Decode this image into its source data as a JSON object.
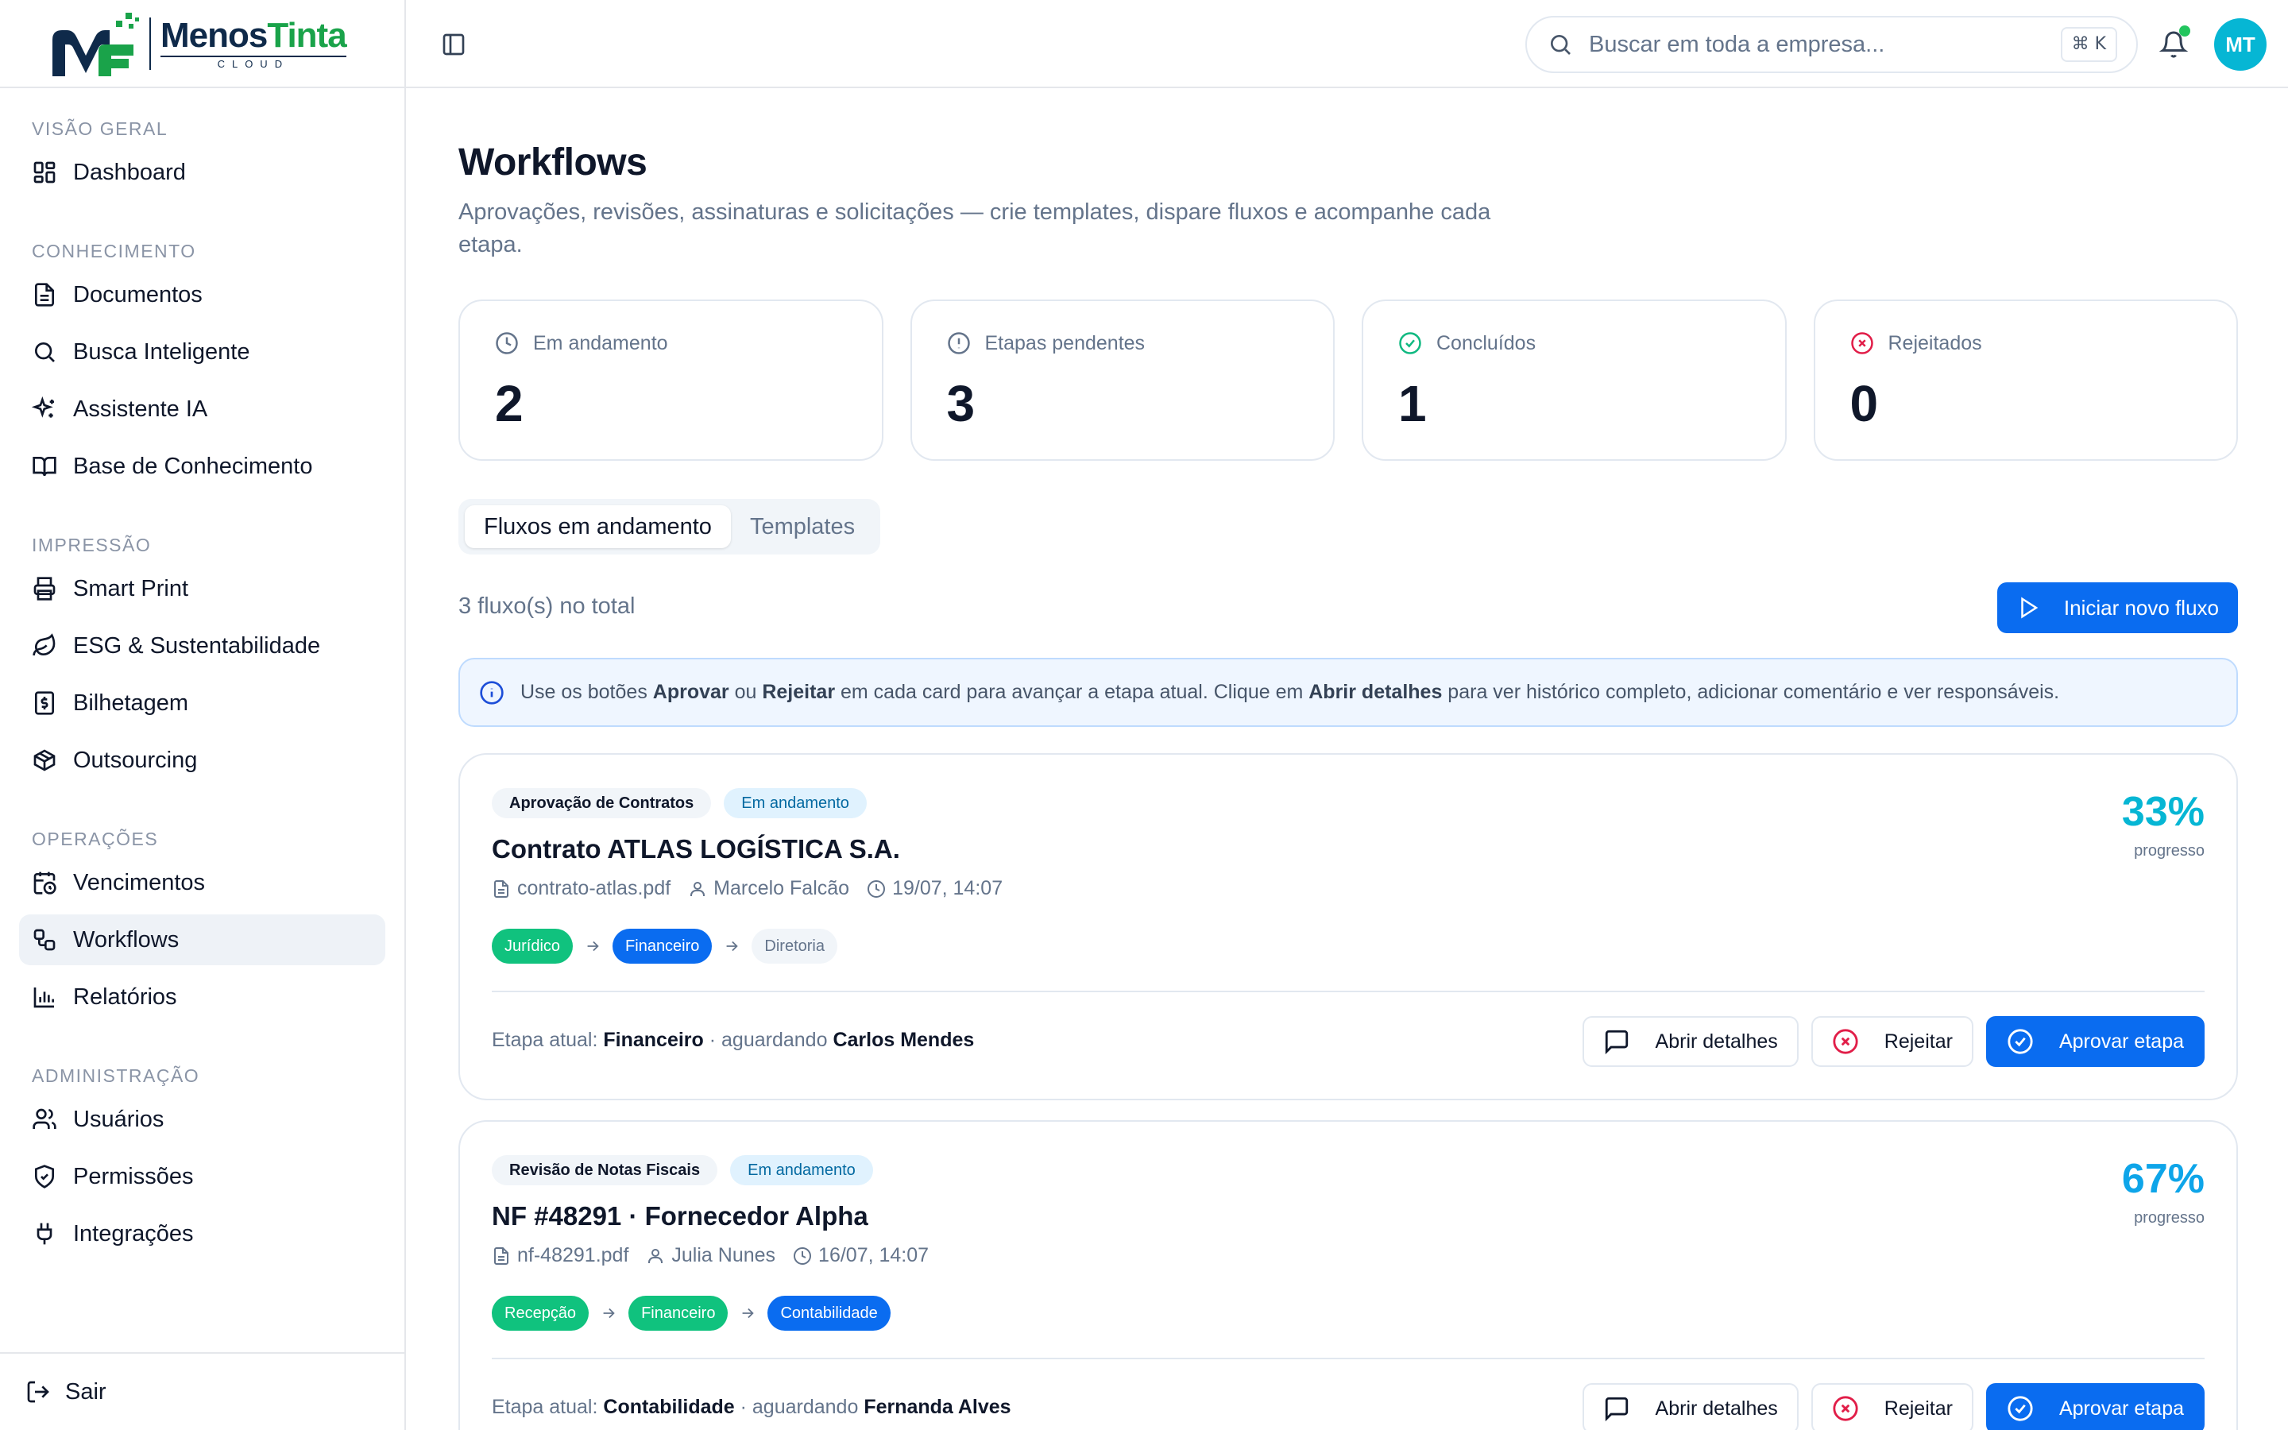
{
  "brand": {
    "name_part1": "Menos",
    "name_part2": "Tinta",
    "sub": "CLOUD"
  },
  "sidebar": {
    "sections": [
      {
        "title": "VISÃO GERAL",
        "items": [
          {
            "label": "Dashboard",
            "icon": "dashboard-icon"
          }
        ]
      },
      {
        "title": "CONHECIMENTO",
        "items": [
          {
            "label": "Documentos",
            "icon": "file-icon"
          },
          {
            "label": "Busca Inteligente",
            "icon": "search-icon"
          },
          {
            "label": "Assistente IA",
            "icon": "sparkles-icon"
          },
          {
            "label": "Base de Conhecimento",
            "icon": "book-icon"
          }
        ]
      },
      {
        "title": "IMPRESSÃO",
        "items": [
          {
            "label": "Smart Print",
            "icon": "printer-icon"
          },
          {
            "label": "ESG & Sustentabilidade",
            "icon": "leaf-icon"
          },
          {
            "label": "Bilhetagem",
            "icon": "receipt-icon"
          },
          {
            "label": "Outsourcing",
            "icon": "package-icon"
          }
        ]
      },
      {
        "title": "OPERAÇÕES",
        "items": [
          {
            "label": "Vencimentos",
            "icon": "calendar-clock-icon"
          },
          {
            "label": "Workflows",
            "icon": "workflow-icon",
            "active": true
          },
          {
            "label": "Relatórios",
            "icon": "bar-chart-icon"
          }
        ]
      },
      {
        "title": "ADMINISTRAÇÃO",
        "items": [
          {
            "label": "Usuários",
            "icon": "users-icon"
          },
          {
            "label": "Permissões",
            "icon": "shield-icon"
          },
          {
            "label": "Integrações",
            "icon": "plug-icon"
          }
        ]
      }
    ],
    "logout": "Sair"
  },
  "topbar": {
    "search_placeholder": "Buscar em toda a empresa...",
    "shortcut": "⌘ K",
    "avatar": "MT"
  },
  "page": {
    "title": "Workflows",
    "subtitle": "Aprovações, revisões, assinaturas e solicitações — crie templates, dispare fluxos e acompanhe cada etapa."
  },
  "stats": [
    {
      "label": "Em andamento",
      "value": "2",
      "icon": "clock-icon",
      "color": "#64748b"
    },
    {
      "label": "Etapas pendentes",
      "value": "3",
      "icon": "alert-circle-icon",
      "color": "#64748b"
    },
    {
      "label": "Concluídos",
      "value": "1",
      "icon": "check-circle-icon",
      "color": "#10b981"
    },
    {
      "label": "Rejeitados",
      "value": "0",
      "icon": "x-circle-icon",
      "color": "#e11d48"
    }
  ],
  "tabs": [
    "Fluxos em andamento",
    "Templates"
  ],
  "list": {
    "total": "3 fluxo(s) no total",
    "new_flow": "Iniciar novo fluxo",
    "info_pre": "Use os botões ",
    "info_b1": "Aprovar",
    "info_mid1": " ou ",
    "info_b2": "Rejeitar",
    "info_mid2": " em cada card para avançar a etapa atual. Clique em ",
    "info_b3": "Abrir detalhes",
    "info_post": " para ver histórico completo, adicionar comentário e ver responsáveis."
  },
  "flows": [
    {
      "type": "Aprovação de Contratos",
      "status": "Em andamento",
      "title": "Contrato ATLAS LOGÍSTICA S.A.",
      "file": "contrato-atlas.pdf",
      "owner": "Marcelo Falcão",
      "date": "19/07, 14:07",
      "progress": "33%",
      "progress_label": "progresso",
      "steps": [
        {
          "label": "Jurídico",
          "state": "done"
        },
        {
          "label": "Financeiro",
          "state": "current"
        },
        {
          "label": "Diretoria",
          "state": "todo"
        }
      ],
      "current_prefix": "Etapa atual: ",
      "current_step": "Financeiro",
      "waiting_prefix": " · aguardando ",
      "waiting_person": "Carlos Mendes",
      "btn_details": "Abrir detalhes",
      "btn_reject": "Rejeitar",
      "btn_approve": "Aprovar etapa"
    },
    {
      "type": "Revisão de Notas Fiscais",
      "status": "Em andamento",
      "title": "NF #48291 · Fornecedor Alpha",
      "file": "nf-48291.pdf",
      "owner": "Julia Nunes",
      "date": "16/07, 14:07",
      "progress": "67%",
      "progress_label": "progresso",
      "steps": [
        {
          "label": "Recepção",
          "state": "done"
        },
        {
          "label": "Financeiro",
          "state": "done"
        },
        {
          "label": "Contabilidade",
          "state": "current"
        }
      ],
      "current_prefix": "Etapa atual: ",
      "current_step": "Contabilidade",
      "waiting_prefix": " · aguardando ",
      "waiting_person": "Fernanda Alves",
      "btn_details": "Abrir detalhes",
      "btn_reject": "Rejeitar",
      "btn_approve": "Aprovar etapa"
    }
  ]
}
